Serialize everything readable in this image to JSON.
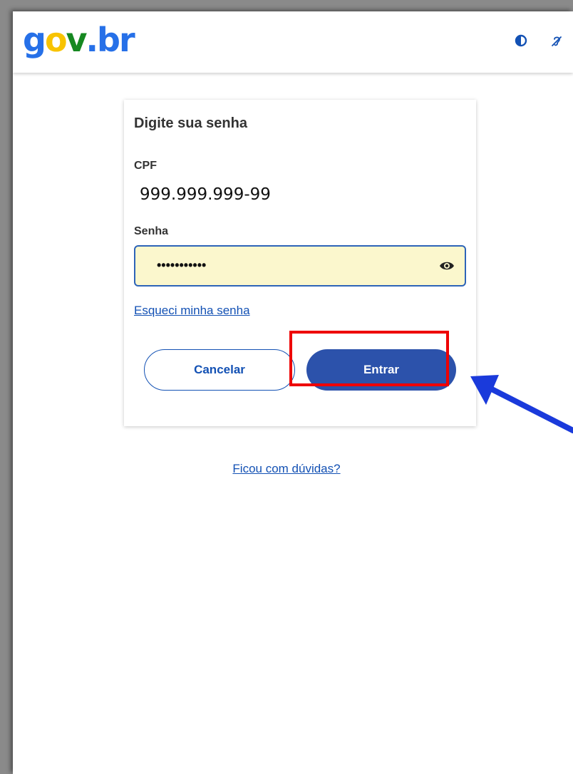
{
  "header": {
    "logo": {
      "g": "g",
      "o": "o",
      "v": "v",
      "dot": ".",
      "b": "b",
      "r": "r"
    },
    "icons": [
      "contrast-icon",
      "hearing-accessibility-icon"
    ]
  },
  "card": {
    "title": "Digite sua senha",
    "cpf_label": "CPF",
    "cpf_value": "999.999.999-99",
    "password_label": "Senha",
    "password_value": "•••••••••••",
    "forgot_link": "Esqueci minha senha",
    "cancel_label": "Cancelar",
    "enter_label": "Entrar"
  },
  "help_link": "Ficou com dúvidas?",
  "colors": {
    "brand_blue": "#1351b4",
    "button_blue": "#2c52ab",
    "field_bg": "#fbf7cd",
    "highlight_red": "#ee0000",
    "arrow_blue": "#1a3adb"
  }
}
